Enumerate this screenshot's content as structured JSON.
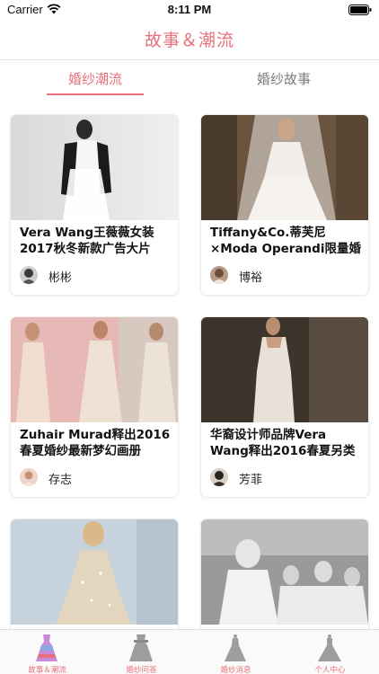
{
  "status_bar": {
    "carrier": "Carrier",
    "time": "8:11 PM"
  },
  "nav": {
    "title": "故事＆潮流"
  },
  "tabs": [
    {
      "label": "婚纱潮流",
      "active": true
    },
    {
      "label": "婚纱故事",
      "active": false
    }
  ],
  "cards": [
    {
      "title": "Vera Wang王薇薇女装2017秋冬新款广告大片",
      "author": "彬彬",
      "photo_icon": "bride-black-sleeves-photo"
    },
    {
      "title": "Tiffany&Co.蒂芙尼×Moda Operandi限量婚纱系列",
      "author": "博裕",
      "photo_icon": "bride-veil-lace-photo"
    },
    {
      "title": "Zuhair Murad释出2016春夏婚纱最新梦幻画册",
      "author": "存志",
      "photo_icon": "lace-gowns-pink-photo"
    },
    {
      "title": "华裔设计师品牌Vera Wang释出2016春夏另类婚",
      "author": "芳菲",
      "photo_icon": "ivory-slip-dress-photo"
    },
    {
      "title": "",
      "author": "",
      "photo_icon": "sparkle-gown-photo"
    },
    {
      "title": "",
      "author": "",
      "photo_icon": "bridal-party-bw-photo"
    }
  ],
  "tab_bar": {
    "items": [
      {
        "label": "故事＆潮流",
        "icon": "dress-icon"
      },
      {
        "label": "婚纱问答",
        "icon": "dress-icon"
      },
      {
        "label": "婚纱消息",
        "icon": "gown-icon"
      },
      {
        "label": "个人中心",
        "icon": "gown-icon"
      }
    ]
  },
  "colors": {
    "accent": "#e8707a",
    "inactive_tab": "#7c7c7c",
    "tab_icon_inactive": "#9e9e9e"
  }
}
